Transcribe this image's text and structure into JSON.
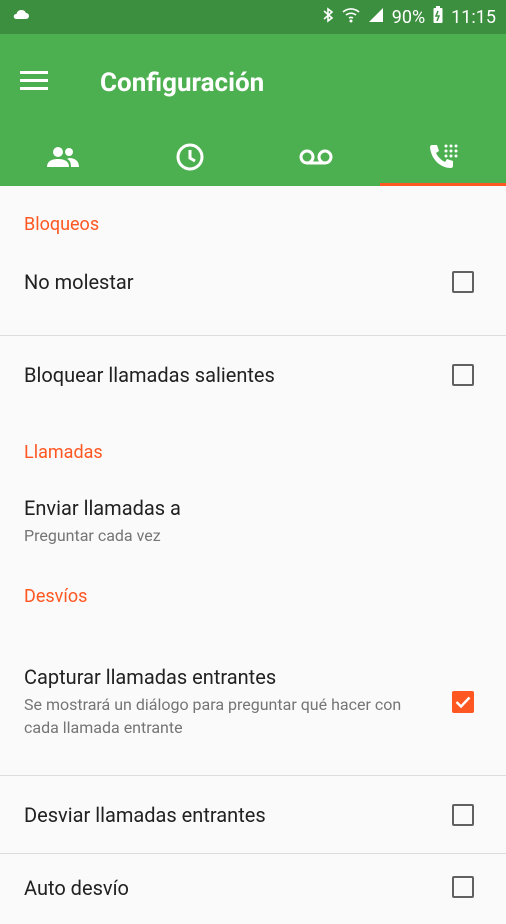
{
  "status_bar": {
    "battery": "90%",
    "time": "11:15"
  },
  "app_bar": {
    "title": "Configuración"
  },
  "tabs": [
    {
      "icon": "contacts-icon",
      "active": false
    },
    {
      "icon": "clock-icon",
      "active": false
    },
    {
      "icon": "voicemail-icon",
      "active": false
    },
    {
      "icon": "call-dialpad-icon",
      "active": true
    }
  ],
  "sections": {
    "bloqueos": "Bloqueos",
    "llamadas": "Llamadas",
    "desvios": "Desvíos"
  },
  "settings": {
    "no_molestar": {
      "label": "No molestar",
      "checked": false
    },
    "bloquear_salientes": {
      "label": "Bloquear llamadas salientes",
      "checked": false
    },
    "enviar_llamadas": {
      "label": "Enviar llamadas a",
      "summary": "Preguntar cada vez"
    },
    "capturar_entrantes": {
      "label": "Capturar llamadas entrantes",
      "summary": "Se mostrará un diálogo para preguntar qué hacer con cada llamada entrante",
      "checked": true
    },
    "desviar_entrantes": {
      "label": "Desviar llamadas entrantes",
      "checked": false
    },
    "auto_desvio": {
      "label": "Auto desvío",
      "checked": false
    }
  },
  "colors": {
    "primary": "#4caf50",
    "status_bar": "#3c8f3e",
    "accent": "#ff5722"
  }
}
